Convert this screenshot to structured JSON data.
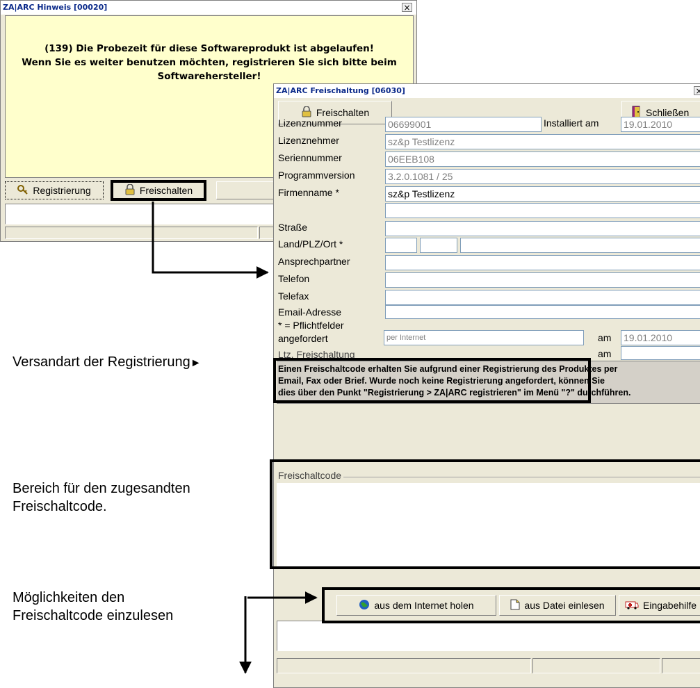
{
  "hinweis": {
    "title": "ZA|ARC Hinweis [00020]",
    "close": "×",
    "message_lines": [
      "(139) Die Probezeit für diese Softwareprodukt ist abgelaufen!",
      "Wenn Sie es weiter benutzen möchten, registrieren Sie sich bitte beim",
      "Softwarehersteller!"
    ],
    "registrierung_label": "Registrierung",
    "freischalten_label": "Freischalten"
  },
  "freischaltung": {
    "title": "ZA|ARC Freischaltung [06030]",
    "close": "×",
    "freischalten_label": "Freischalten",
    "schliessen_label": "Schließen",
    "fields": {
      "lizenznummer_label": "Lizenznummer",
      "lizenznummer_value": "06699001",
      "installiert_label": "Installiert am",
      "installiert_value": "19.01.2010",
      "lizenznehmer_label": "Lizenznehmer",
      "lizenznehmer_value": "sz&p Testlizenz",
      "seriennummer_label": "Seriennummer",
      "seriennummer_value": "06EEB108",
      "programmversion_label": "Programmversion",
      "programmversion_value": "3.2.0.1081 / 25",
      "firmenname_label": "Firmenname *",
      "firmenname_value": "sz&p Testlizenz",
      "strasse_label": "Straße",
      "landplzort_label": "Land/PLZ/Ort *",
      "ansprechpartner_label": "Ansprechpartner",
      "telefon_label": "Telefon",
      "telefax_label": "Telefax",
      "email_label": "Email-Adresse",
      "pflicht_label": "* = Pflichtfelder",
      "angefordert_label": "angefordert",
      "angefordert_value": "per Internet",
      "am_label": "am",
      "angefordert_am_value": "19.01.2010",
      "ltz_label": "Ltz. Freischaltung",
      "ltz_am_label": "am"
    },
    "info_text_lines": [
      "Einen Freischaltcode erhalten Sie aufgrund einer Registrierung des Produktes per",
      "Email, Fax oder Brief. Wurde noch keine Registrierung angefordert, können Sie",
      "dies über den Punkt \"Registrierung > ZA|ARC registrieren\" im Menü \"?\" durchführen."
    ],
    "freischaltcode_legend": "Freischaltcode",
    "buttons": {
      "internet_label": "aus dem Internet holen",
      "datei_label": "aus Datei einlesen",
      "eingabehilfe_label": "Eingabehilfe"
    }
  },
  "annotations": {
    "versandart": "Versandart der Registrierung",
    "bereich_line1": "Bereich für den zugesandten",
    "bereich_line2": "Freischaltcode.",
    "moeglichkeiten_line1": "Möglichkeiten den",
    "moeglichkeiten_line2": "Freischaltcode einzulesen"
  },
  "colors": {
    "hinweis_bg": "#ffffcc",
    "dialog_bg": "#ece9d8",
    "title_text": "#0b2a8a",
    "readonly_text": "#808080"
  }
}
